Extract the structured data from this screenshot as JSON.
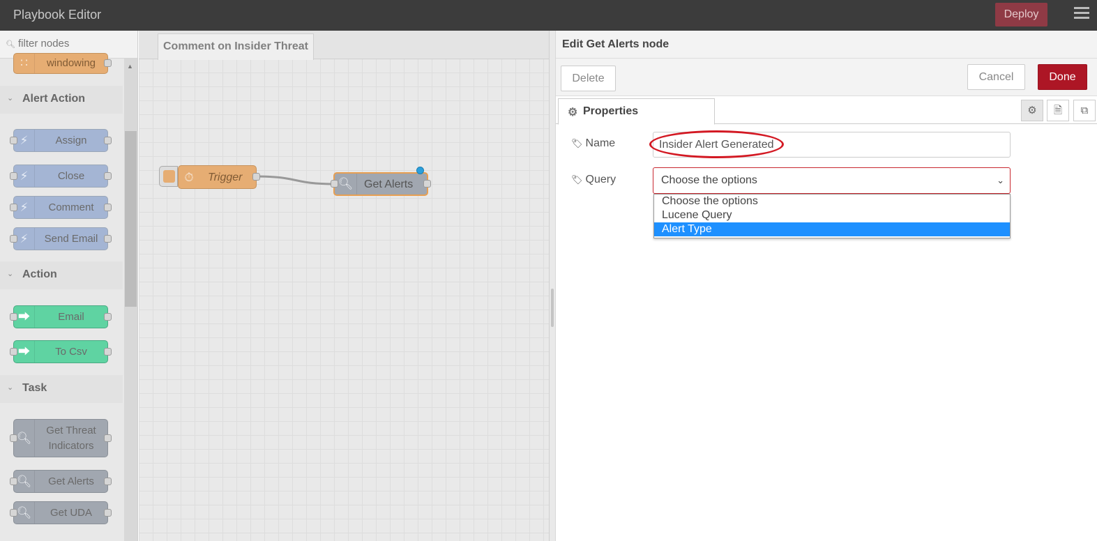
{
  "header": {
    "title": "Playbook Editor",
    "deploy_label": "Deploy"
  },
  "palette": {
    "filter_placeholder": "filter nodes",
    "partial_node": "windowing",
    "categories": {
      "alert_action": {
        "label": "Alert Action",
        "nodes": [
          "Assign",
          "Close",
          "Comment",
          "Send Email"
        ]
      },
      "action": {
        "label": "Action",
        "nodes": [
          "Email",
          "To Csv"
        ]
      },
      "task": {
        "label": "Task",
        "nodes": [
          "Get Threat Indicators",
          "Get Alerts",
          "Get UDA"
        ]
      }
    }
  },
  "workspace": {
    "tab_label": "Comment on Insider Threat",
    "nodes": {
      "trigger": "Trigger",
      "get_alerts": "Get Alerts"
    }
  },
  "editor": {
    "title": "Edit Get Alerts node",
    "delete_label": "Delete",
    "cancel_label": "Cancel",
    "done_label": "Done",
    "tab_properties": "Properties",
    "name_label": "Name",
    "name_value": "Insider Alert Generated",
    "query_label": "Query",
    "query_selected": "Choose the options",
    "query_options": [
      "Choose the options",
      "Lucene Query",
      "Alert Type"
    ]
  },
  "colors": {
    "header_bg": "#3c3c3c",
    "deploy_bg": "#8f3a45",
    "done_bg": "#ad1625",
    "alert_action_node": "#a4b5d4",
    "action_node": "#5fd3a2",
    "task_node": "#a1a7b0",
    "trigger_node": "#e6ad73",
    "selected_option": "#1e90ff",
    "annotation": "#d31923"
  }
}
